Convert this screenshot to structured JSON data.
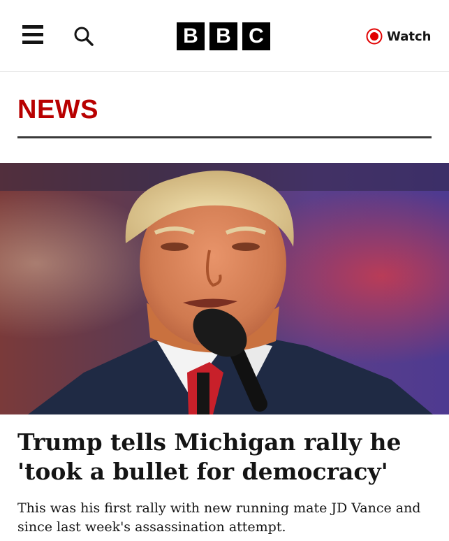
{
  "header": {
    "menu_icon": "hamburger-menu-icon",
    "search_icon": "search-icon",
    "logo_letters": [
      "B",
      "B",
      "C"
    ],
    "watch_label": "Watch",
    "watch_icon": "live-record-icon",
    "accent_color": "#b80000"
  },
  "section": {
    "title": "NEWS"
  },
  "article": {
    "image_alt_icon": "news-photo",
    "headline": "Trump tells Michigan rally he 'took a bullet for democracy'",
    "summary": "This was his first rally with new running mate JD Vance and since last week's assassination attempt."
  }
}
